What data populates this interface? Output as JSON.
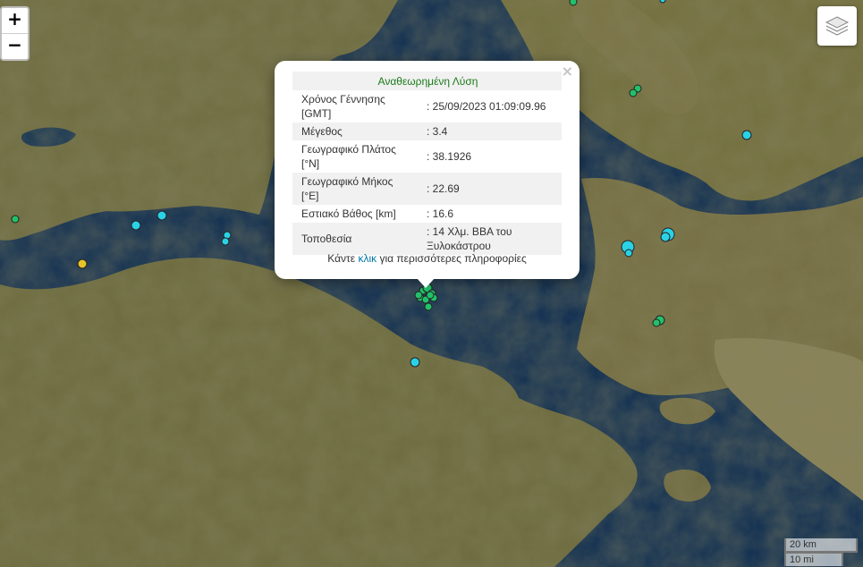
{
  "map": {
    "zoom_in_label": "+",
    "zoom_out_label": "−",
    "layers_icon": "layers-icon",
    "colors": {
      "land": "#6b6a3e",
      "sea": "#0d2c4f",
      "marker_cyan": "#2ad2e6",
      "marker_green": "#23c06a",
      "marker_yellow": "#e6c32a"
    }
  },
  "popup": {
    "title": "Αναθεωρημένη Λύση",
    "rows": [
      {
        "label": "Χρόνος Γέννησης [GMT]",
        "value": ": 25/09/2023 01:09:09.96"
      },
      {
        "label": "Μέγεθος",
        "value": ": 3.4"
      },
      {
        "label": "Γεωγραφικό Πλάτος [°N]",
        "value": ": 38.1926"
      },
      {
        "label": "Γεωγραφικό Μήκος [°E]",
        "value": ": 22.69"
      },
      {
        "label": "Εστιακό Βάθος [km]",
        "value": ": 16.6"
      },
      {
        "label": "Τοποθεσία",
        "value": ": 14 Χλμ. ΒΒΑ του Ξυλοκάστρου"
      }
    ],
    "more_prefix": "Κάντε ",
    "more_link": "κλικ",
    "more_suffix": " για περισσότερες πληροφορίες",
    "close_label": "×"
  },
  "scale": {
    "metric": "20 km",
    "imperial": "10 mi"
  }
}
